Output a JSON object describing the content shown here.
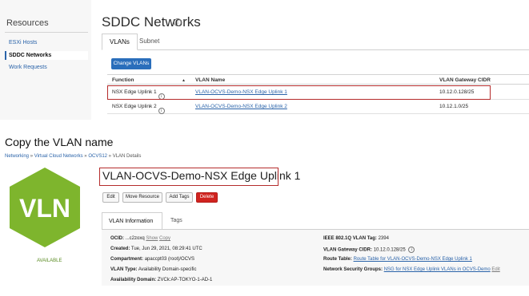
{
  "top": {
    "sidebar": {
      "title": "Resources",
      "items": [
        {
          "label": "ESXi Hosts"
        },
        {
          "label": "SDDC Networks"
        },
        {
          "label": "Work Requests"
        }
      ]
    },
    "page_title": "SDDC Networks",
    "info_glyph": "i",
    "tabs": [
      {
        "label": "VLANs"
      },
      {
        "label": "Subnet"
      }
    ],
    "change_button": "Change VLANs",
    "table": {
      "headers": [
        "Function",
        "VLAN Name",
        "VLAN Gateway CIDR"
      ],
      "sort_glyph": "▲",
      "rows": [
        {
          "function": "NSX Edge Uplink 1",
          "name": "VLAN-OCVS-Demo-NSX Edge Uplink 1",
          "cidr": "10.12.0.128/25"
        },
        {
          "function": "NSX Edge Uplink 2",
          "name": "VLAN-OCVS-Demo-NSX Edge Uplink 2",
          "cidr": "10.12.1.0/25"
        }
      ]
    }
  },
  "caption": "Copy the VLAN name",
  "bottom": {
    "breadcrumb": {
      "items": [
        "Networking",
        "Virtual Cloud Networks",
        "OCVS12",
        "VLAN Details"
      ],
      "separator": "»"
    },
    "badge_text": "VLN",
    "badge_color": "#7eb52d",
    "status": "AVAILABLE",
    "title": "VLAN-OCVS-Demo-NSX Edge Uplink 1",
    "buttons": [
      {
        "label": "Edit"
      },
      {
        "label": "Move Resource"
      },
      {
        "label": "Add Tags"
      },
      {
        "label": "Delete"
      }
    ],
    "tabs": [
      {
        "label": "VLAN Information"
      },
      {
        "label": "Tags"
      }
    ],
    "info": {
      "ocid_label": "OCID:",
      "ocid_value": "...c2zoxq",
      "show": "Show",
      "copy": "Copy",
      "created_label": "Created:",
      "created_value": "Tue, Jun 29, 2021, 08:29:41 UTC",
      "compartment_label": "Compartment:",
      "compartment_value": "apaccpt03 (root)/OCVS",
      "vlan_type_label": "VLAN Type:",
      "vlan_type_value": "Availability Domain-specific",
      "ad_label": "Availability Domain:",
      "ad_value": "ZVCk:AP-TOKYO-1-AD-1",
      "tag_label": "IEEE 802.1Q VLAN Tag:",
      "tag_value": "2394",
      "cidr_label": "VLAN Gateway CIDR:",
      "cidr_value": "10.12.0.128/25",
      "route_label": "Route Table:",
      "route_value": "Route Table for VLAN-OCVS-Demo-NSX Edge Uplink 1",
      "nsg_label": "Network Security Groups:",
      "nsg_value": "NSG for NSX Edge Uplink VLANs in OCVS-Demo",
      "nsg_edit": "Edit"
    }
  }
}
